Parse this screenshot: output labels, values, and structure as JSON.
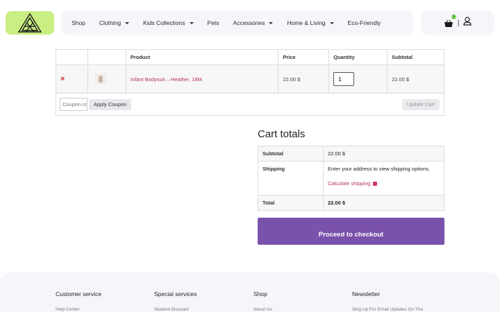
{
  "header": {
    "nav": [
      {
        "label": "Shop",
        "dropdown": false
      },
      {
        "label": "Clothing",
        "dropdown": true
      },
      {
        "label": "Kids Collections",
        "dropdown": true
      },
      {
        "label": "Pets",
        "dropdown": false
      },
      {
        "label": "Accessories",
        "dropdown": true
      },
      {
        "label": "Home & Living",
        "dropdown": true
      },
      {
        "label": "Eco-Friendly",
        "dropdown": false
      }
    ],
    "cart_count": "1",
    "separator": "|"
  },
  "cart": {
    "columns": {
      "product": "Product",
      "price": "Price",
      "quantity": "Quantity",
      "subtotal": "Subtotal"
    },
    "item": {
      "remove": "×",
      "name": "Infant Bodysuit – Heather, 18M",
      "price": "22.00 $",
      "quantity": "1",
      "subtotal": "22.00 $"
    },
    "coupon_placeholder": "Coupon code",
    "apply_coupon": "Apply Coupon",
    "update_cart": "Update Cart"
  },
  "totals": {
    "title": "Cart totals",
    "subtotal_label": "Subtotal",
    "subtotal_value": "22.00 $",
    "shipping_label": "Shipping",
    "shipping_note": "Enter your address to view shipping options.",
    "calculate_shipping": "Calculate shipping",
    "total_label": "Total",
    "total_value": "22.00 $",
    "checkout": "Proceed to checkout"
  },
  "footer": {
    "columns": [
      {
        "heading": "Customer service",
        "link": "Help Center"
      },
      {
        "heading": "Special services",
        "link": "Student Discount"
      },
      {
        "heading": "Shop",
        "link": "About Us"
      },
      {
        "heading": "Newsletter",
        "link": "Sing Up For Email Updates On The"
      }
    ]
  },
  "colors": {
    "logo_bg": "#c9ee82",
    "accent_link": "#b5325a",
    "checkout_bg": "#7b52ab",
    "remove": "#d62828"
  }
}
